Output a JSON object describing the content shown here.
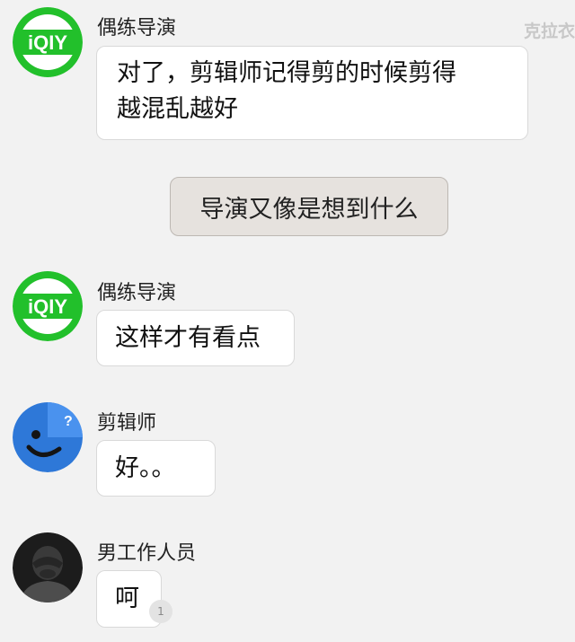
{
  "watermark": "克拉衣",
  "messages": [
    {
      "sender": "偶练导演",
      "avatar_icon": "iqiyi-logo-icon",
      "lines": [
        "对了，剪辑师记得剪的时候剪得",
        "越混乱越好"
      ]
    },
    {
      "sender": "偶练导演",
      "avatar_icon": "iqiyi-logo-icon",
      "text": "这样才有看点"
    },
    {
      "sender": "剪辑师",
      "avatar_icon": "blue-smiley-question-icon",
      "text": "好。。"
    },
    {
      "sender": "男工作人员",
      "avatar_icon": "person-photo-avatar",
      "text": "呵"
    }
  ],
  "system_button": {
    "label": "导演又像是想到什么"
  },
  "unread_badge": "1",
  "colors": {
    "iqiyi_green": "#22c02b",
    "avatar_blue": "#2e78d8",
    "background": "#f2f2f2",
    "system_button_bg": "#e6e2de"
  }
}
